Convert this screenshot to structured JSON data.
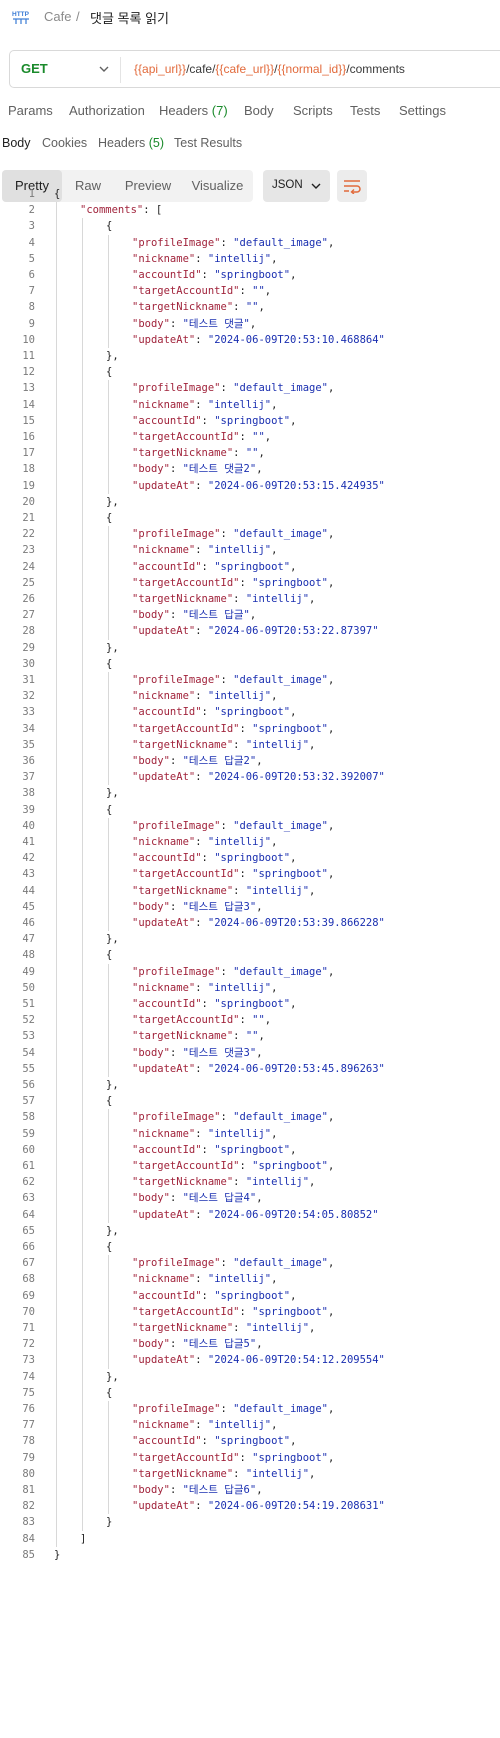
{
  "breadcrumb": {
    "parent": "Cafe",
    "separator": "/",
    "title": "댓글 목록 읽기"
  },
  "request": {
    "method": "GET",
    "url_parts": [
      {
        "text": "{{api_url}}",
        "var": true
      },
      {
        "text": "/cafe/",
        "var": false
      },
      {
        "text": "{{cafe_url}}",
        "var": true
      },
      {
        "text": "/",
        "var": false
      },
      {
        "text": "{{normal_id}}",
        "var": true
      },
      {
        "text": "/comments",
        "var": false
      }
    ]
  },
  "request_tabs": {
    "params": "Params",
    "authorization": "Authorization",
    "headers": "Headers",
    "headers_count": "(7)",
    "body": "Body",
    "scripts": "Scripts",
    "tests": "Tests",
    "settings": "Settings"
  },
  "response_tabs": {
    "body": "Body",
    "cookies": "Cookies",
    "headers": "Headers",
    "headers_count": "(5)",
    "test_results": "Test Results"
  },
  "view_modes": {
    "pretty": "Pretty",
    "raw": "Raw",
    "preview": "Preview",
    "visualize": "Visualize",
    "active": "Pretty"
  },
  "format": "JSON",
  "colors": {
    "method_get": "#1a8a2b",
    "variable": "#e26a3b",
    "json_key": "#a1243c",
    "json_string": "#1a2fb0"
  },
  "icons": [
    "http-icon",
    "chevron-down-icon",
    "wrap-lines-icon"
  ],
  "comments": [
    {
      "profileImage": "default_image",
      "nickname": "intellij",
      "accountId": "springboot",
      "targetAccountId": "",
      "targetNickname": "",
      "body": "테스트 댓글",
      "updateAt": "2024-06-09T20:53:10.468864"
    },
    {
      "profileImage": "default_image",
      "nickname": "intellij",
      "accountId": "springboot",
      "targetAccountId": "",
      "targetNickname": "",
      "body": "테스트 댓글2",
      "updateAt": "2024-06-09T20:53:15.424935"
    },
    {
      "profileImage": "default_image",
      "nickname": "intellij",
      "accountId": "springboot",
      "targetAccountId": "springboot",
      "targetNickname": "intellij",
      "body": "테스트 답글",
      "updateAt": "2024-06-09T20:53:22.87397"
    },
    {
      "profileImage": "default_image",
      "nickname": "intellij",
      "accountId": "springboot",
      "targetAccountId": "springboot",
      "targetNickname": "intellij",
      "body": "테스트 답글2",
      "updateAt": "2024-06-09T20:53:32.392007"
    },
    {
      "profileImage": "default_image",
      "nickname": "intellij",
      "accountId": "springboot",
      "targetAccountId": "springboot",
      "targetNickname": "intellij",
      "body": "테스트 답글3",
      "updateAt": "2024-06-09T20:53:39.866228"
    },
    {
      "profileImage": "default_image",
      "nickname": "intellij",
      "accountId": "springboot",
      "targetAccountId": "",
      "targetNickname": "",
      "body": "테스트 댓글3",
      "updateAt": "2024-06-09T20:53:45.896263"
    },
    {
      "profileImage": "default_image",
      "nickname": "intellij",
      "accountId": "springboot",
      "targetAccountId": "springboot",
      "targetNickname": "intellij",
      "body": "테스트 답글4",
      "updateAt": "2024-06-09T20:54:05.80852"
    },
    {
      "profileImage": "default_image",
      "nickname": "intellij",
      "accountId": "springboot",
      "targetAccountId": "springboot",
      "targetNickname": "intellij",
      "body": "테스트 답글5",
      "updateAt": "2024-06-09T20:54:12.209554"
    },
    {
      "profileImage": "default_image",
      "nickname": "intellij",
      "accountId": "springboot",
      "targetAccountId": "springboot",
      "targetNickname": "intellij",
      "body": "테스트 답글6",
      "updateAt": "2024-06-09T20:54:19.208631"
    }
  ]
}
